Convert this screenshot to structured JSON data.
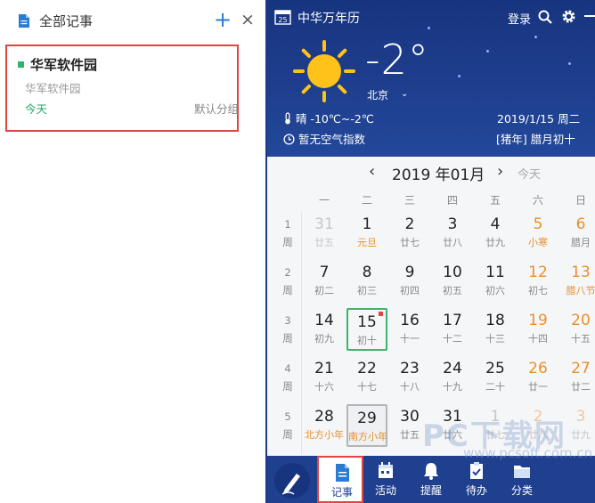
{
  "notes": {
    "header_title": "全部记事",
    "add_label": "+",
    "close_label": "×",
    "items": [
      {
        "title": "华军软件园",
        "summary": "华军软件园",
        "date": "今天",
        "group": "默认分组"
      }
    ]
  },
  "calendar": {
    "app_title": "中华万年历",
    "app_icon_day": "25",
    "login": "登录",
    "weather": {
      "temp": "-2°",
      "city": "北京",
      "city_arrow": "⌄",
      "condition": "晴 -10℃~-2℃",
      "air": "暂无空气指数",
      "date": "2019/1/15 周二",
      "lunar": "[猪年] 腊月初十"
    },
    "month_title": "2019 年01月",
    "prev": "‹",
    "next": "›",
    "today_btn": "今天",
    "weekdays": [
      "一",
      "二",
      "三",
      "四",
      "五",
      "六",
      "日"
    ],
    "weeks": [
      {
        "num": "1",
        "label": "周",
        "days": [
          {
            "d": "31",
            "l": "廿五",
            "other": true
          },
          {
            "d": "1",
            "l": "元旦",
            "fest": true
          },
          {
            "d": "2",
            "l": "廿七"
          },
          {
            "d": "3",
            "l": "廿八"
          },
          {
            "d": "4",
            "l": "廿九"
          },
          {
            "d": "5",
            "l": "小寒",
            "fest": true,
            "we": true
          },
          {
            "d": "6",
            "l": "腊月",
            "we": true
          }
        ]
      },
      {
        "num": "2",
        "label": "周",
        "days": [
          {
            "d": "7",
            "l": "初二"
          },
          {
            "d": "8",
            "l": "初三"
          },
          {
            "d": "9",
            "l": "初四"
          },
          {
            "d": "10",
            "l": "初五"
          },
          {
            "d": "11",
            "l": "初六"
          },
          {
            "d": "12",
            "l": "初七",
            "we": true
          },
          {
            "d": "13",
            "l": "腊八节",
            "fest": true,
            "we": true
          }
        ]
      },
      {
        "num": "3",
        "label": "周",
        "days": [
          {
            "d": "14",
            "l": "初九"
          },
          {
            "d": "15",
            "l": "初十",
            "today": true
          },
          {
            "d": "16",
            "l": "十一"
          },
          {
            "d": "17",
            "l": "十二"
          },
          {
            "d": "18",
            "l": "十三"
          },
          {
            "d": "19",
            "l": "十四",
            "we": true
          },
          {
            "d": "20",
            "l": "十五",
            "we": true
          }
        ]
      },
      {
        "num": "4",
        "label": "周",
        "days": [
          {
            "d": "21",
            "l": "十六"
          },
          {
            "d": "22",
            "l": "十七"
          },
          {
            "d": "23",
            "l": "十八"
          },
          {
            "d": "24",
            "l": "十九"
          },
          {
            "d": "25",
            "l": "二十"
          },
          {
            "d": "26",
            "l": "廿一",
            "we": true
          },
          {
            "d": "27",
            "l": "廿二",
            "we": true
          }
        ]
      },
      {
        "num": "5",
        "label": "周",
        "days": [
          {
            "d": "28",
            "l": "北方小年",
            "fest": true
          },
          {
            "d": "29",
            "l": "南方小年",
            "fest": true,
            "sel": true
          },
          {
            "d": "30",
            "l": "廿五"
          },
          {
            "d": "31",
            "l": "廿六"
          },
          {
            "d": "1",
            "l": "廿七",
            "other": true
          },
          {
            "d": "2",
            "l": "廿八",
            "other": true,
            "we": true
          },
          {
            "d": "3",
            "l": "廿九",
            "other": true,
            "we": true
          }
        ]
      }
    ],
    "tabs": [
      {
        "label": "记事",
        "icon": "note-icon",
        "active": true
      },
      {
        "label": "活动",
        "icon": "calendar-icon"
      },
      {
        "label": "提醒",
        "icon": "bell-icon"
      },
      {
        "label": "待办",
        "icon": "todo-icon"
      },
      {
        "label": "分类",
        "icon": "folder-icon"
      }
    ]
  },
  "watermark": {
    "main": "PC下载网",
    "sub": "www.pcsoft.com.cn"
  },
  "colors": {
    "accent": "#2b7bd3",
    "navy": "#1f3f8f",
    "highlight_red": "#e04545",
    "today_green": "#3db56b",
    "festival_orange": "#e8902a"
  }
}
